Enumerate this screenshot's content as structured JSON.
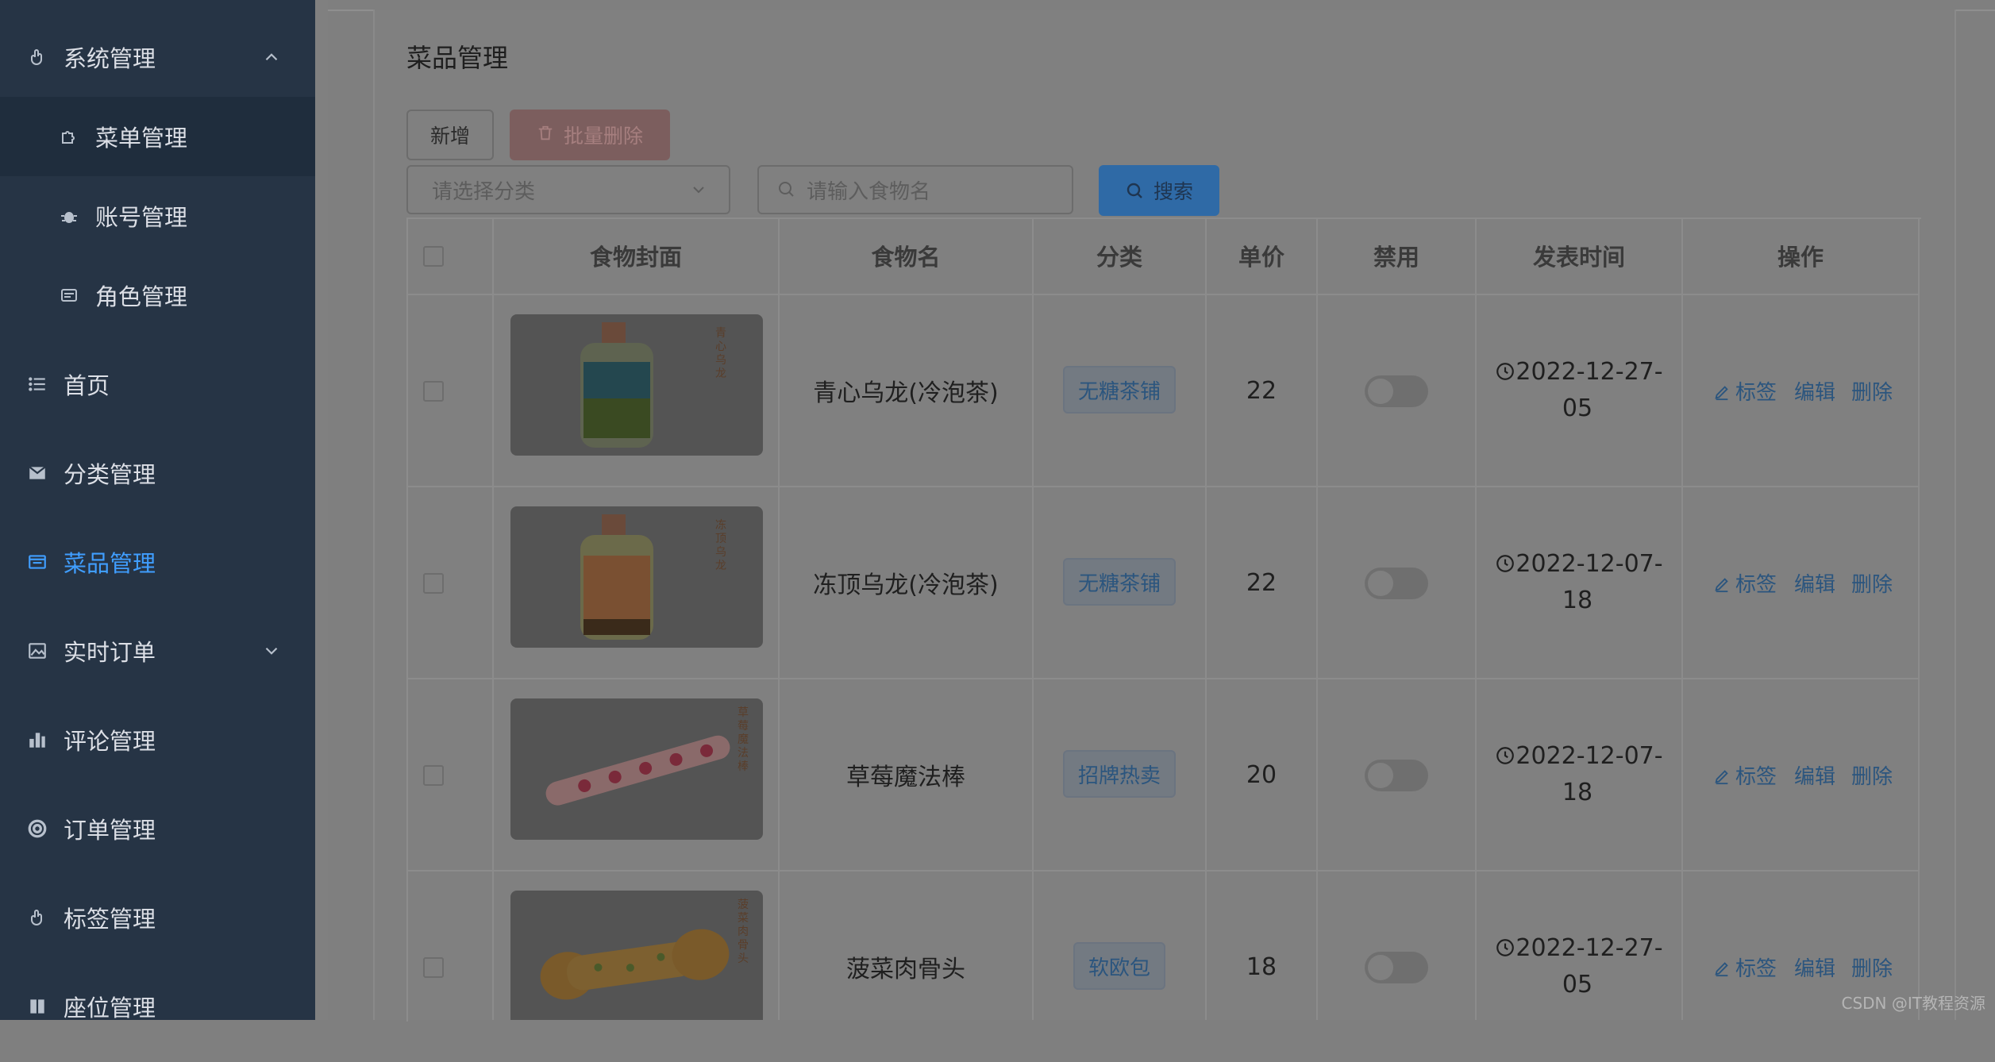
{
  "sidebar": {
    "items": [
      {
        "label": "系统管理",
        "icon": "hand-pointer-icon"
      },
      {
        "label": "菜单管理",
        "icon": "puzzle-icon"
      },
      {
        "label": "账号管理",
        "icon": "bug-icon"
      },
      {
        "label": "角色管理",
        "icon": "id-card-icon"
      },
      {
        "label": "首页",
        "icon": "list-icon"
      },
      {
        "label": "分类管理",
        "icon": "mail-icon"
      },
      {
        "label": "菜品管理",
        "icon": "window-icon"
      },
      {
        "label": "实时订单",
        "icon": "image-icon"
      },
      {
        "label": "评论管理",
        "icon": "bar-chart-icon"
      },
      {
        "label": "订单管理",
        "icon": "lifebuoy-icon"
      },
      {
        "label": "标签管理",
        "icon": "hand-pointer-icon"
      },
      {
        "label": "座位管理",
        "icon": "book-icon"
      }
    ],
    "accent_color": "#409eff"
  },
  "page": {
    "title": "菜品管理"
  },
  "toolbar": {
    "add_label": "新增",
    "batch_delete_label": "批量删除",
    "category_placeholder": "请选择分类",
    "food_name_placeholder": "请输入食物名",
    "search_label": "搜索"
  },
  "table": {
    "headers": [
      "食物封面",
      "食物名",
      "分类",
      "单价",
      "禁用",
      "发表时间",
      "操作"
    ],
    "actions": {
      "tag": "标签",
      "edit": "编辑",
      "delete": "删除"
    },
    "rows": [
      {
        "name": "青心乌龙(冷泡茶)",
        "category": "无糖茶铺",
        "price": "22",
        "time_line1": "2022-12-27-",
        "time_line2": "05",
        "cover_label": "青心乌龙"
      },
      {
        "name": "冻顶乌龙(冷泡茶)",
        "category": "无糖茶铺",
        "price": "22",
        "time_line1": "2022-12-07-",
        "time_line2": "18",
        "cover_label": "冻顶乌龙"
      },
      {
        "name": "草莓魔法棒",
        "category": "招牌热卖",
        "price": "20",
        "time_line1": "2022-12-07-",
        "time_line2": "18",
        "cover_label": "草莓魔法棒"
      },
      {
        "name": "菠菜肉骨头",
        "category": "软欧包",
        "price": "18",
        "time_line1": "2022-12-27-",
        "time_line2": "05",
        "cover_label": "菠菜肉骨头"
      }
    ]
  },
  "watermark": "CSDN @IT教程资源"
}
